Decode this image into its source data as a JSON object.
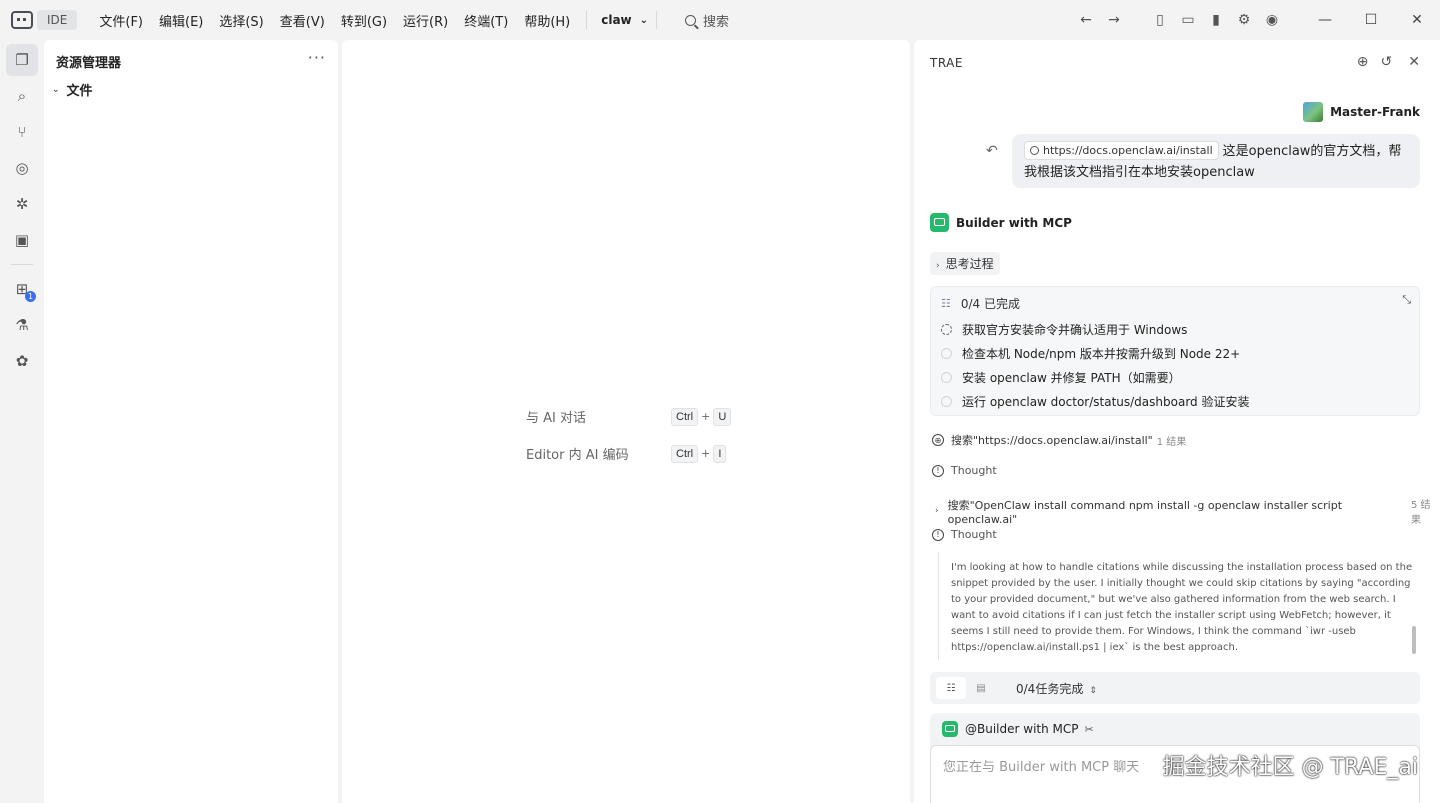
{
  "titlebar": {
    "ide_label": "IDE",
    "menu": [
      "文件(F)",
      "编辑(E)",
      "选择(S)",
      "查看(V)",
      "转到(G)",
      "运行(R)",
      "终端(T)",
      "帮助(H)"
    ],
    "project": "claw",
    "search_label": "搜索"
  },
  "explorer": {
    "title": "资源管理器",
    "folder": "文件"
  },
  "activity": {
    "extensions_badge": "1"
  },
  "editor": {
    "hints": [
      {
        "label": "与 AI 对话",
        "key1": "Ctrl",
        "plus": "+",
        "key2": "U"
      },
      {
        "label": "Editor 内 AI 编码",
        "key1": "Ctrl",
        "plus": "+",
        "key2": "I"
      }
    ]
  },
  "chat": {
    "header": "TRAE",
    "user_name": "Master-Frank",
    "user_message": {
      "link": "https://docs.openclaw.ai/install",
      "text": "这是openclaw的官方文档，帮我根据该文档指引在本地安装openclaw"
    },
    "agent_name": "Builder with MCP",
    "think_label": "思考过程",
    "todo": {
      "header": "0/4 已完成",
      "items": [
        "获取官方安装命令并确认适用于 Windows",
        "检查本机 Node/npm 版本并按需升级到 Node 22+",
        "安装 openclaw 并修复 PATH（如需要）",
        "运行 openclaw doctor/status/dashboard 验证安装"
      ]
    },
    "steps": {
      "search1": "搜索\"https://docs.openclaw.ai/install\"",
      "search1_count": "1 结果",
      "thought1": "Thought",
      "search2": "搜索\"OpenClaw install command npm install -g openclaw installer script openclaw.ai\"",
      "search2_count": "5 结果",
      "thought2": "Thought"
    },
    "thought_text": "I'm looking at how to handle citations while discussing the installation process based on the snippet provided by the user. I initially thought we could skip citations by saying \"according to your provided document,\" but we've also gathered information from the web search. I want to avoid citations if I can just fetch the installer script using WebFetch; however, it seems I still need to provide them. For Windows, I think the command `iwr -useb https://openclaw.ai/install.ps1 | iex` is the best approach.",
    "task_status": "0/4任务完成",
    "input_agent": "@Builder with MCP",
    "input_placeholder": "您正在与 Builder with MCP 聊天",
    "watermark": "掘金技术社区 @ TRAE_ai"
  }
}
